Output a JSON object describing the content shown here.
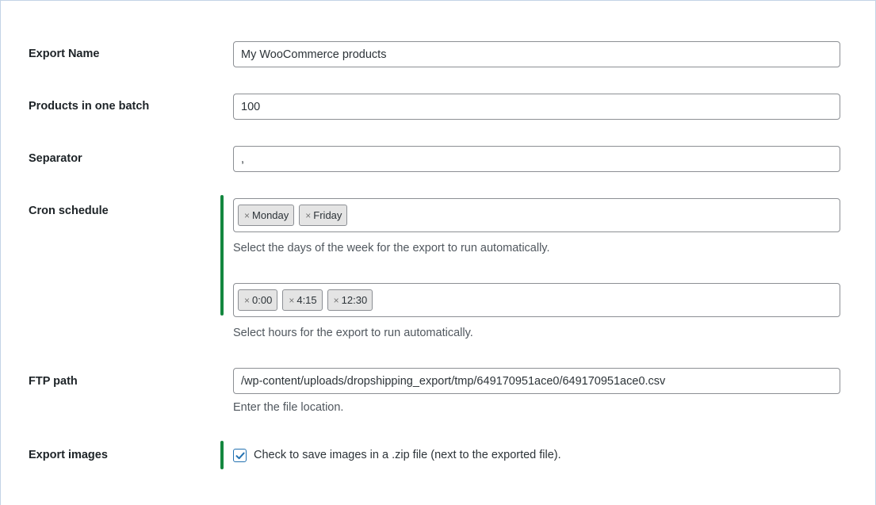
{
  "export_name": {
    "label": "Export Name",
    "value": "My WooCommerce products"
  },
  "batch": {
    "label": "Products in one batch",
    "value": "100"
  },
  "separator": {
    "label": "Separator",
    "value": ","
  },
  "cron": {
    "label": "Cron schedule",
    "days": [
      "Monday",
      "Friday"
    ],
    "days_desc": "Select the days of the week for the export to run automatically.",
    "hours": [
      "0:00",
      "4:15",
      "12:30"
    ],
    "hours_desc": "Select hours for the export to run automatically.",
    "remove_glyph": "×"
  },
  "ftp": {
    "label": "FTP path",
    "value": "/wp-content/uploads/dropshipping_export/tmp/649170951ace0/649170951ace0.csv",
    "desc": "Enter the file location."
  },
  "images": {
    "label": "Export images",
    "checked": true,
    "checkbox_label": "Check to save images in a .zip file (next to the exported file)."
  },
  "colors": {
    "accent": "#14873f",
    "checkbox": "#2271b1"
  }
}
